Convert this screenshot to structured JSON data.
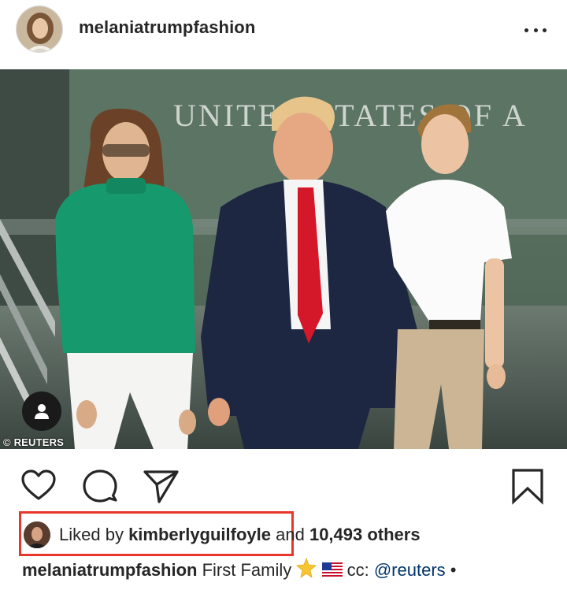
{
  "header": {
    "username": "melaniatrumpfashion",
    "avatar_icon": "profile-avatar",
    "more_icon": "more-horizontal-icon"
  },
  "photo": {
    "credit": "© REUTERS",
    "sign_text": "UNITED STATES OF A",
    "user_tag_icon": "user-tag-icon"
  },
  "actions": {
    "like_icon": "heart-icon",
    "comment_icon": "comment-icon",
    "share_icon": "send-icon",
    "save_icon": "bookmark-icon"
  },
  "likes": {
    "prefix": "Liked by ",
    "liker": "kimberlyguilfoyle",
    "middle": " and ",
    "others": "10,493 others"
  },
  "caption": {
    "username": "melaniatrumpfashion",
    "text": " First Family ",
    "cc": " cc: ",
    "mention": "@reuters",
    "bullet": " •"
  },
  "colors": {
    "highlight": "#e8362a",
    "text": "#262626",
    "mention": "#003569"
  }
}
